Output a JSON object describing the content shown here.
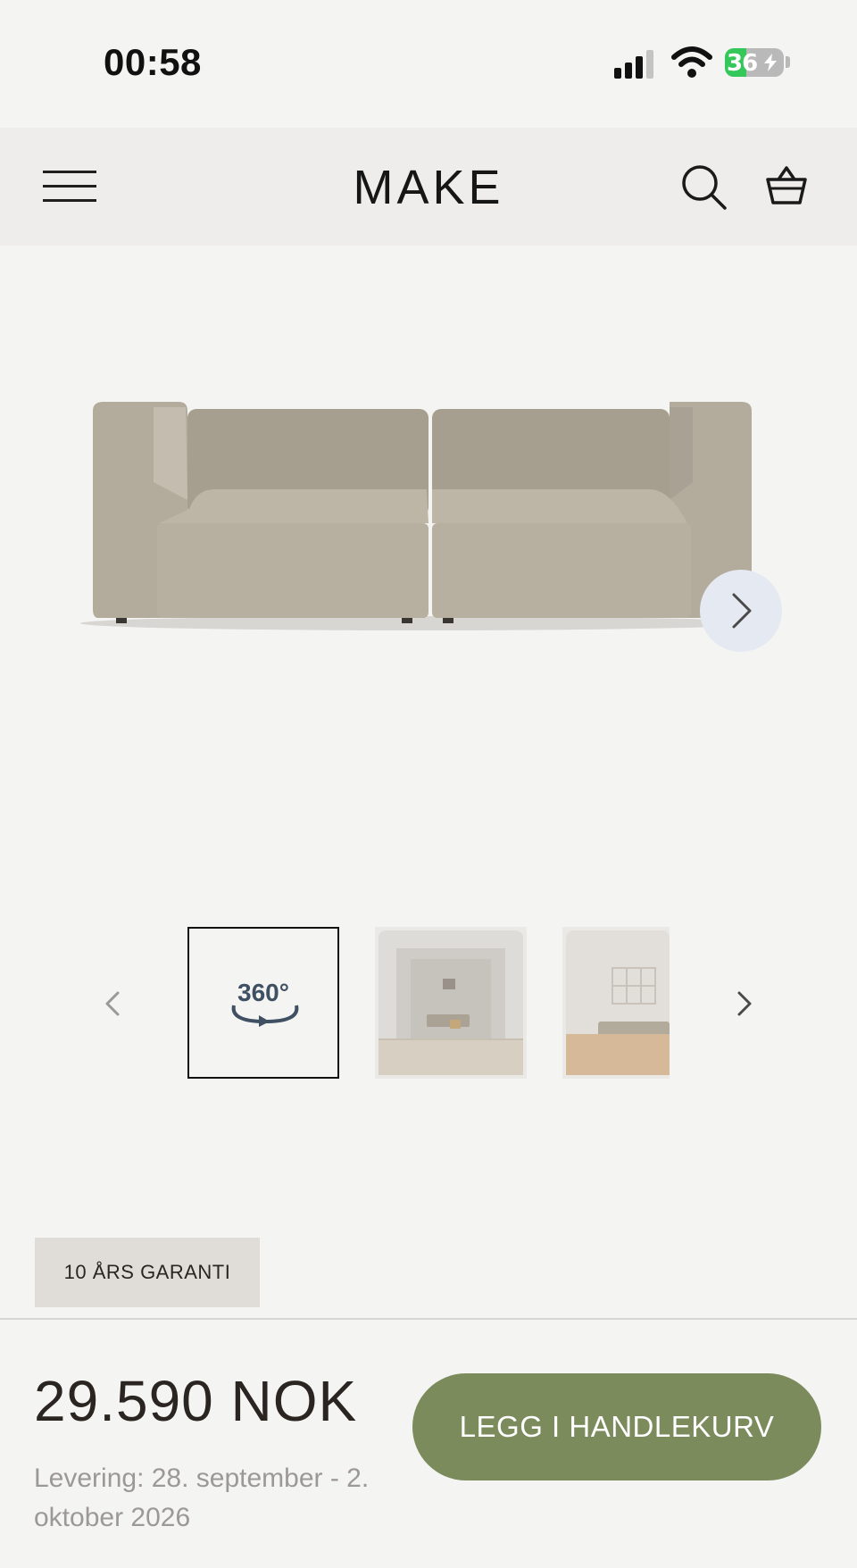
{
  "status_bar": {
    "time": "00:58",
    "battery_level": "36"
  },
  "header": {
    "logo": "MAKE"
  },
  "thumbnails": {
    "label_360": "360°"
  },
  "badge": {
    "warranty": "10 ÅRS GARANTI"
  },
  "purchase": {
    "price": "29.590 NOK",
    "delivery": "Levering: 28. september - 2. oktober 2026",
    "add_to_cart_label": "LEGG I HANDLEKURV"
  },
  "colors": {
    "background": "#f4f4f3",
    "accent_button": "#7b8b5c",
    "badge_bg": "#e0dcd7",
    "battery_green": "#34c759"
  }
}
